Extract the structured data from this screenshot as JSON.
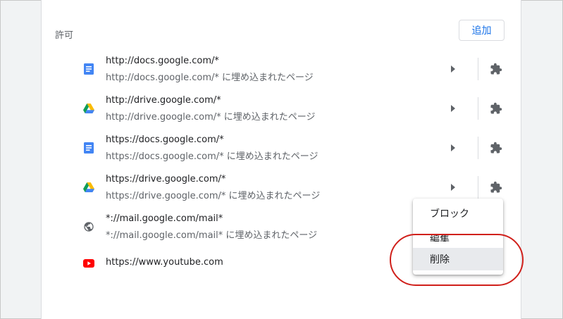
{
  "section": {
    "title": "許可",
    "add_button": "追加"
  },
  "rows": [
    {
      "icon": "google-docs-icon",
      "url": "http://docs.google.com/*",
      "sub": "http://docs.google.com/* に埋め込まれたページ"
    },
    {
      "icon": "google-drive-icon",
      "url": "http://drive.google.com/*",
      "sub": "http://drive.google.com/* に埋め込まれたページ"
    },
    {
      "icon": "google-docs-icon",
      "url": "https://docs.google.com/*",
      "sub": "https://docs.google.com/* に埋め込まれたページ"
    },
    {
      "icon": "google-drive-icon",
      "url": "https://drive.google.com/*",
      "sub": "https://drive.google.com/* に埋め込まれたページ"
    },
    {
      "icon": "globe-icon",
      "url": "*://mail.google.com/mail*",
      "sub": "*://mail.google.com/mail* に埋め込まれたページ"
    },
    {
      "icon": "youtube-icon",
      "url": "https://www.youtube.com",
      "sub": ""
    }
  ],
  "menu": {
    "items": [
      "ブロック",
      "編集",
      "削除"
    ],
    "highlighted": "削除"
  },
  "colors": {
    "accent": "#1a73e8",
    "annotation": "#d0201b",
    "icon_gray": "#5f6368",
    "docs_blue": "#4285f4",
    "youtube_red": "#ff0000"
  }
}
